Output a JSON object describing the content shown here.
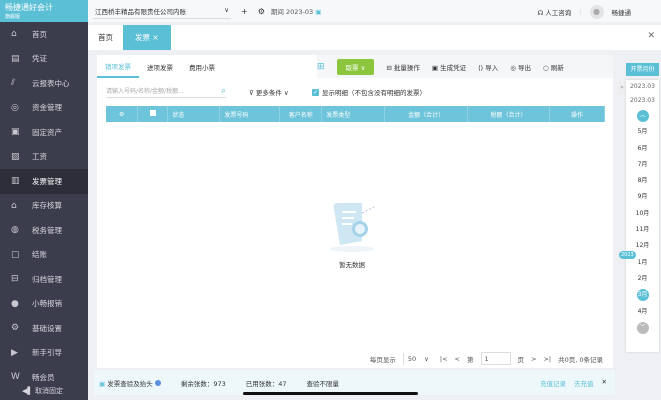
{
  "app": {
    "logo_title": "畅捷通好会计",
    "logo_sub": "旗舰版"
  },
  "sidebar": {
    "items": [
      {
        "label": "首页",
        "icon": "home-icon",
        "glyph": "⌂"
      },
      {
        "label": "凭证",
        "icon": "voucher-icon",
        "glyph": "▤"
      },
      {
        "label": "云报表中心",
        "icon": "chart-icon",
        "glyph": "⫽"
      },
      {
        "label": "资金管理",
        "icon": "money-icon",
        "glyph": "◎"
      },
      {
        "label": "固定资产",
        "icon": "asset-icon",
        "glyph": "▣"
      },
      {
        "label": "工资",
        "icon": "salary-icon",
        "glyph": "▨"
      },
      {
        "label": "发票管理",
        "icon": "invoice-icon",
        "glyph": "▥"
      },
      {
        "label": "库存核算",
        "icon": "stock-icon",
        "glyph": "⌂"
      },
      {
        "label": "税务管理",
        "icon": "tax-icon",
        "glyph": "◍"
      },
      {
        "label": "结账",
        "icon": "checkout-icon",
        "glyph": "▢"
      },
      {
        "label": "归档管理",
        "icon": "archive-icon",
        "glyph": "⊟"
      },
      {
        "label": "小畅报销",
        "icon": "reimburse-icon",
        "glyph": "●"
      },
      {
        "label": "基础设置",
        "icon": "settings-icon",
        "glyph": "⚙"
      },
      {
        "label": "新手引导",
        "icon": "guide-icon",
        "glyph": "▶"
      },
      {
        "label": "畅会员",
        "icon": "member-icon",
        "glyph": "W"
      }
    ],
    "unpin": "取消固定"
  },
  "topbar": {
    "company": "江西桥丰精品有限责任公司内账",
    "period_label": "期间",
    "period_value": "2023-03",
    "support": "人工咨询",
    "user": "畅捷通"
  },
  "tabs": [
    {
      "label": "首页"
    },
    {
      "label": "发票 ×"
    }
  ],
  "subtabs": [
    "销项发票",
    "进项发票",
    "费用小票"
  ],
  "toolbar": {
    "fetch": "取票 ∨",
    "batch": "批量操作",
    "gen_voucher": "生成凭证",
    "import": "导入",
    "export": "导出",
    "refresh": "刷新"
  },
  "filters": {
    "search_placeholder": "请输入号码/名称/金额/税额...",
    "more": "更多条件 ∨",
    "show_detail": "显示明细（不包含没有明细的发票）"
  },
  "table": {
    "columns": [
      "⚙",
      "",
      "状态",
      "发票号码",
      "客户名称",
      "发票类型",
      "金额（合计）",
      "税额（合计）",
      "操作"
    ],
    "rows": []
  },
  "empty": {
    "text": "暂无数据"
  },
  "pagination": {
    "per_page_label": "每页显示",
    "per_page": "50",
    "page_prefix": "第",
    "page": "1",
    "page_suffix": "页",
    "summary": "共0页, 0条记录"
  },
  "footer": {
    "title": "发票查验及抬头",
    "remaining": "剩余张数：973",
    "used": "已用张数：47",
    "unlimited": "查验不限量",
    "recharge_log": "充值记录",
    "recharge": "去充值"
  },
  "right_panel": {
    "title": "开票月份",
    "dates": [
      "2023.03",
      "2023.03"
    ],
    "year_badge": "2023",
    "months": [
      "5月",
      "6月",
      "7月",
      "8月",
      "9月",
      "10月",
      "11月",
      "12月",
      "1月",
      "2月",
      "3月",
      "4月"
    ],
    "selected_month": "3月"
  },
  "colors": {
    "accent": "#5bbfd6",
    "green": "#8cc63e",
    "sidebar": "#3c3d4c"
  }
}
